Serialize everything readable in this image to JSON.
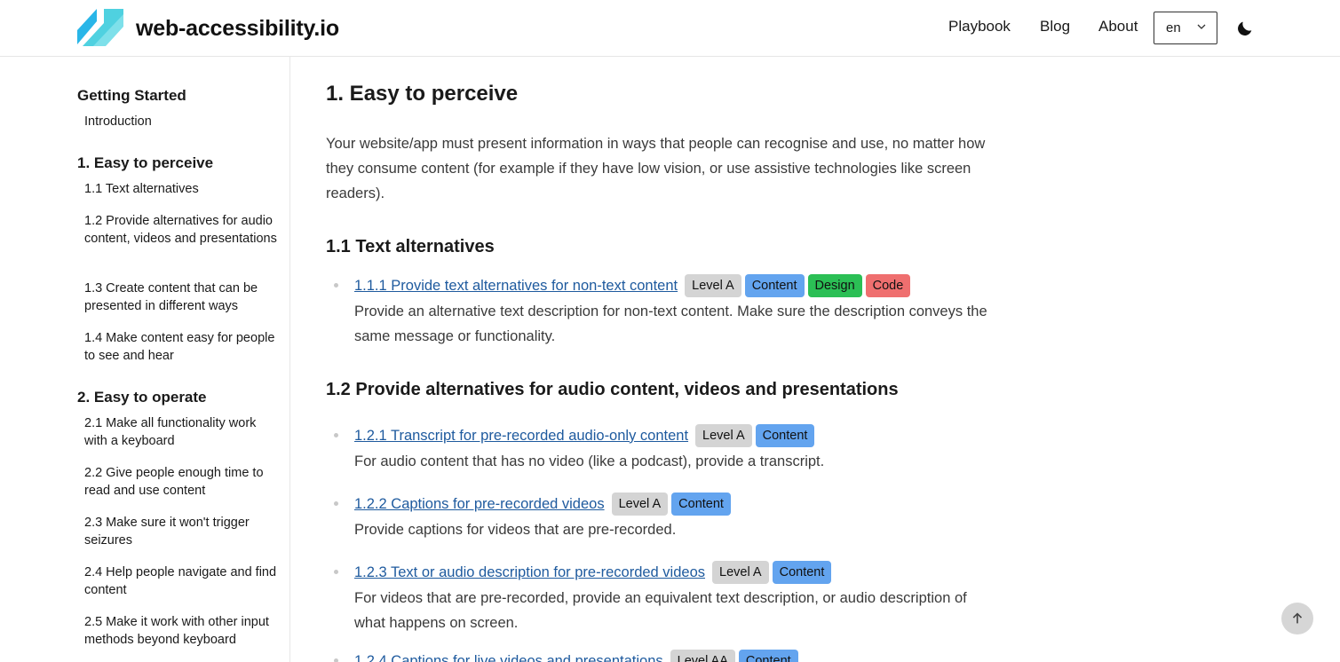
{
  "header": {
    "site_name": "web-accessibility.io",
    "nav": [
      "Playbook",
      "Blog",
      "About"
    ],
    "language": "en",
    "logo_icon": "logo-icon",
    "theme_icon": "moon-icon"
  },
  "sidebar": {
    "sections": [
      {
        "title": "Getting Started",
        "items": [
          "Introduction"
        ]
      },
      {
        "title": "1. Easy to perceive",
        "items": [
          "1.1 Text alternatives",
          "1.2 Provide alternatives for audio content, videos and presentations",
          "1.3 Create content that can be presented in different ways",
          "1.4 Make content easy for people to see and hear"
        ]
      },
      {
        "title": "2. Easy to operate",
        "items": [
          "2.1 Make all functionality work with a keyboard",
          "2.2 Give people enough time to read and use content",
          "2.3 Make sure it won't trigger seizures",
          "2.4 Help people navigate and find content",
          "2.5 Make it work with other input methods beyond keyboard"
        ]
      }
    ]
  },
  "main": {
    "title": "1. Easy to perceive",
    "intro": "Your website/app must present information in ways that people can recognise and use, no matter how they consume content (for example if they have low vision, or use assistive technologies like screen readers).",
    "sections": [
      {
        "title": "1.1 Text alternatives",
        "criteria": [
          {
            "link": "1.1.1 Provide text alternatives for non-text content",
            "tags": [
              "Level A",
              "Content",
              "Design",
              "Code"
            ],
            "desc": "Provide an alternative text description for non-text content. Make sure the description conveys the same message or functionality."
          }
        ]
      },
      {
        "title": "1.2 Provide alternatives for audio content, videos and presentations",
        "criteria": [
          {
            "link": "1.2.1 Transcript for pre-recorded audio-only content",
            "tags": [
              "Level A",
              "Content"
            ],
            "desc": "For audio content that has no video (like a podcast), provide a transcript."
          },
          {
            "link": "1.2.2 Captions for pre-recorded videos",
            "tags": [
              "Level A",
              "Content"
            ],
            "desc": "Provide captions for videos that are pre-recorded."
          },
          {
            "link": "1.2.3 Text or audio description for pre-recorded videos",
            "tags": [
              "Level A",
              "Content"
            ],
            "desc": "For videos that are pre-recorded, provide an equivalent text description, or audio description of what happens on screen."
          },
          {
            "link": "1.2.4 Captions for live videos and presentations",
            "tags": [
              "Level AA",
              "Content"
            ],
            "desc": ""
          }
        ]
      }
    ]
  },
  "colors": {
    "link": "#1e5a9e",
    "tag_level": "#d4d4d4",
    "tag_content": "#63a4ef",
    "tag_design": "#2bbf55",
    "tag_code": "#ef6f6f"
  }
}
